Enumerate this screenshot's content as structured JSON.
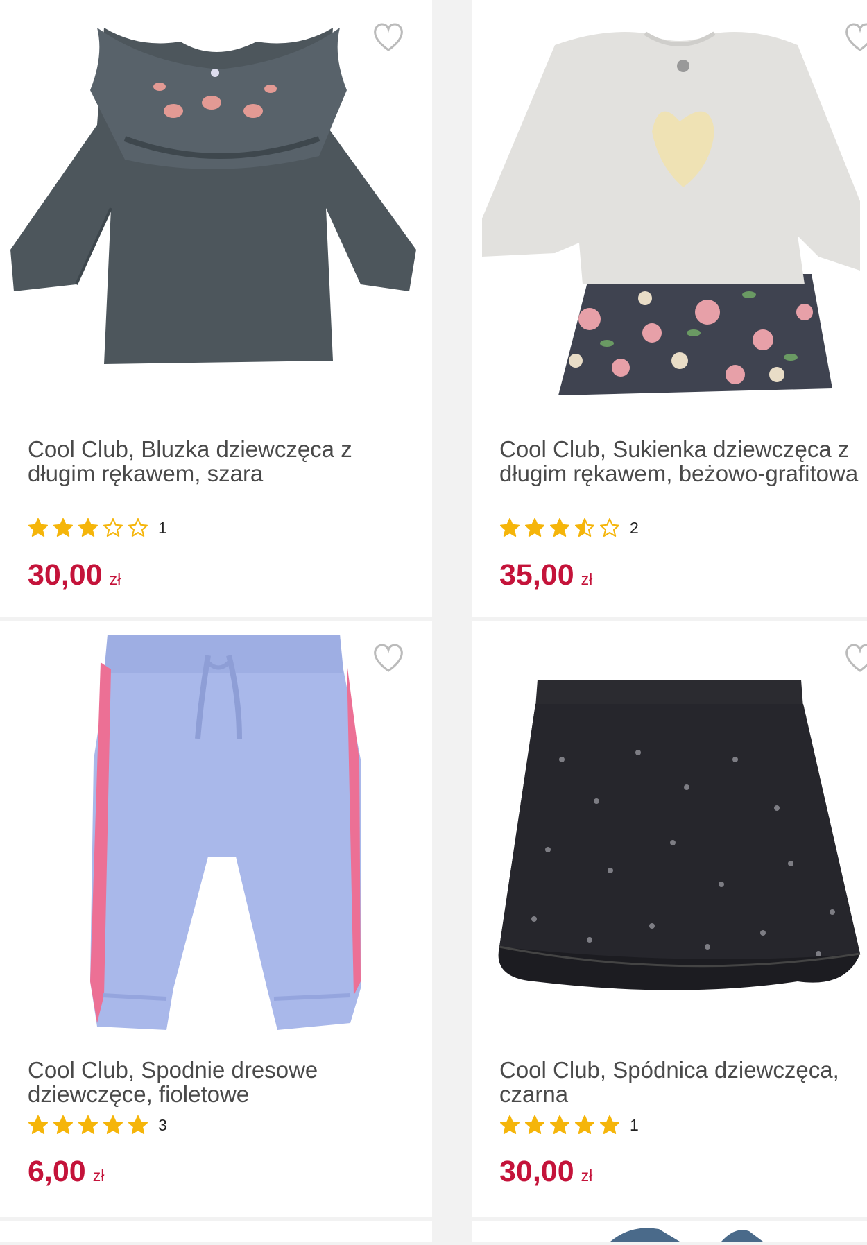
{
  "products": [
    {
      "title": "Cool Club, Bluzka dziewczęca z długim rękawem, szara",
      "rating_count": "1",
      "stars": 3,
      "price": "30,00",
      "currency": "zł",
      "image": "gray-ruffle-blouse"
    },
    {
      "title": "Cool Club, Sukienka dziewczęca z długim rękawem, beżowo-grafitowa",
      "rating_count": "2",
      "stars": 3.5,
      "price": "35,00",
      "currency": "zł",
      "image": "beige-floral-dress"
    },
    {
      "title": "Cool Club, Spodnie dresowe dziewczęce, fioletowe",
      "rating_count": "3",
      "stars": 5,
      "price": "6,00",
      "currency": "zł",
      "image": "lilac-sweatpants"
    },
    {
      "title": "Cool Club, Spódnica dziewczęca, czarna",
      "rating_count": "1",
      "stars": 5,
      "price": "30,00",
      "currency": "zł",
      "image": "black-tulle-skirt"
    }
  ],
  "colors": {
    "price": "#c4133a",
    "star": "#f5b50a",
    "background": "#f2f2f2"
  },
  "icons": {
    "favorite": "heart-outline-icon",
    "rating": "star-icon"
  }
}
